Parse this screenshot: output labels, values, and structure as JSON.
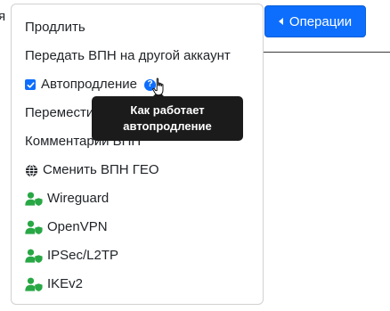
{
  "edge_char": "я",
  "operations_button": {
    "label": "Операции"
  },
  "menu": {
    "items": [
      {
        "label": "Продлить"
      },
      {
        "label": "Передать ВПН на другой аккаунт"
      },
      {
        "label": "Автопродление",
        "checked": true
      },
      {
        "label": "Переместить"
      },
      {
        "label": "Комментарий ВПН"
      },
      {
        "label": "Сменить ВПН ГЕО",
        "icon": "globe-icon"
      },
      {
        "label": "Wireguard",
        "icon": "user-shield-icon"
      },
      {
        "label": "OpenVPN",
        "icon": "user-shield-icon"
      },
      {
        "label": "IPSec/L2TP",
        "icon": "user-shield-icon"
      },
      {
        "label": "IKEv2",
        "icon": "user-shield-icon"
      }
    ]
  },
  "help_icon": {
    "glyph": "?"
  },
  "tooltip": {
    "line1": "Как работает",
    "line2": "автопродление"
  },
  "colors": {
    "primary": "#0d6efd",
    "success": "#28a745",
    "tooltip_bg": "#1b1b1b"
  }
}
